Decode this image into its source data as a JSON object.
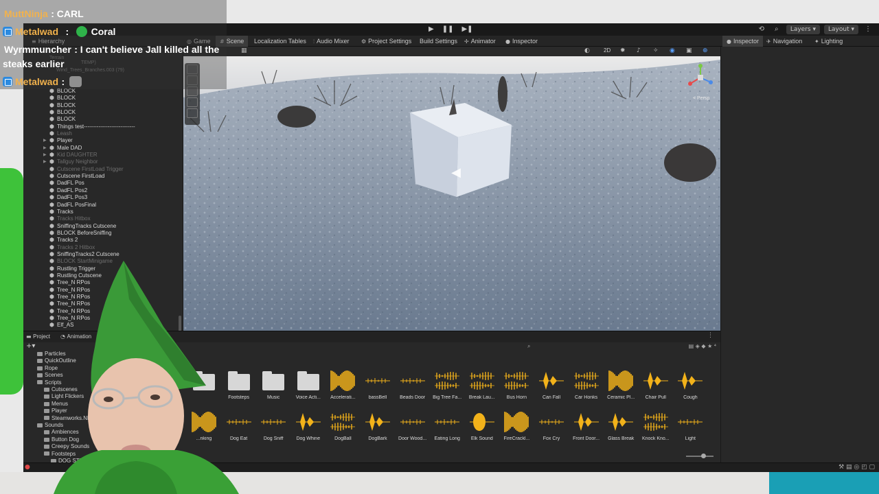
{
  "chat": [
    {
      "user": "MuttNinja",
      "message": ": CARL"
    },
    {
      "user": "Metalwad",
      "message": "Coral"
    },
    {
      "user": "Wyrmmuncher",
      "message": ": I can't believe Jall killed all the",
      "message2": "steaks earlier"
    },
    {
      "user": "Metalwad",
      "message": ":"
    }
  ],
  "toolbar": {
    "play_icons": [
      "▶",
      "❚❚",
      "▶❚"
    ],
    "layers_label": "Layers",
    "layout_label": "Layout"
  },
  "tabs": {
    "hierarchy": "Hierarchy",
    "game": "Game",
    "scene": "Scene",
    "localization": "Localization Tables",
    "audio_mixer": "Audio Mixer",
    "project_settings": "Project Settings",
    "build_settings": "Build Settings",
    "animator": "Animator",
    "inspector_center": "Inspector",
    "inspector": "Inspector",
    "navigation": "Navigation",
    "lighting": "Lighting"
  },
  "scene": {
    "persp_label": "< Persp",
    "mode_2d": "2D"
  },
  "hierarchy": {
    "top_items": [
      "Terrain",
      "Wind_Trees_Branches.003 (79)",
      "TEMP)"
    ],
    "items": [
      {
        "label": "BLOCK",
        "dim": false,
        "fold": false
      },
      {
        "label": "BLOCK",
        "dim": false,
        "fold": false
      },
      {
        "label": "BLOCK",
        "dim": false,
        "fold": false
      },
      {
        "label": "BLOCK",
        "dim": false,
        "fold": false
      },
      {
        "label": "BLOCK",
        "dim": false,
        "fold": false
      },
      {
        "label": "Things test----------------------------",
        "dim": false,
        "fold": false
      },
      {
        "label": "Leash",
        "dim": true,
        "fold": false
      },
      {
        "label": "Player",
        "dim": false,
        "fold": true
      },
      {
        "label": "Male DAD",
        "dim": false,
        "fold": true
      },
      {
        "label": "Kid DAUGHTER",
        "dim": true,
        "fold": true
      },
      {
        "label": "Tallguy Neighbor",
        "dim": true,
        "fold": true
      },
      {
        "label": "Cutscene FirstLoad Trigger",
        "dim": true,
        "fold": false
      },
      {
        "label": "Cutscene FirstLoad",
        "dim": false,
        "fold": false
      },
      {
        "label": "DadFL Pos",
        "dim": false,
        "fold": false
      },
      {
        "label": "DadFL Pos2",
        "dim": false,
        "fold": false
      },
      {
        "label": "DadFL Pos3",
        "dim": false,
        "fold": false
      },
      {
        "label": "DadFL PosFinal",
        "dim": false,
        "fold": false
      },
      {
        "label": "Tracks",
        "dim": false,
        "fold": false
      },
      {
        "label": "Tracks Hitbox",
        "dim": true,
        "fold": false
      },
      {
        "label": "SniffingTracks Cutscene",
        "dim": false,
        "fold": false
      },
      {
        "label": "BLOCK BeforeSniffing",
        "dim": false,
        "fold": false
      },
      {
        "label": "Tracks 2",
        "dim": false,
        "fold": false
      },
      {
        "label": "Tracks 2 Hitbox",
        "dim": true,
        "fold": false
      },
      {
        "label": "SniffingTracks2 Cutscene",
        "dim": false,
        "fold": false
      },
      {
        "label": "BLOCK StartMinigame",
        "dim": true,
        "fold": false
      },
      {
        "label": "Rustling Trigger",
        "dim": false,
        "fold": false
      },
      {
        "label": "Rustling Cutscene",
        "dim": false,
        "fold": false
      },
      {
        "label": "Tree_N RPos",
        "dim": false,
        "fold": false
      },
      {
        "label": "Tree_N RPos",
        "dim": false,
        "fold": false
      },
      {
        "label": "Tree_N RPos",
        "dim": false,
        "fold": false
      },
      {
        "label": "Tree_N RPos",
        "dim": false,
        "fold": false
      },
      {
        "label": "Tree_N RPos",
        "dim": false,
        "fold": false
      },
      {
        "label": "Tree_N RPos",
        "dim": false,
        "fold": false
      },
      {
        "label": "Elf_AS",
        "dim": false,
        "fold": false
      }
    ]
  },
  "project": {
    "tab_project": "Project",
    "tab_animation": "Animation",
    "tree": [
      {
        "label": "Particles",
        "indent": 2
      },
      {
        "label": "QuickOutline",
        "indent": 2
      },
      {
        "label": "Rope",
        "indent": 2
      },
      {
        "label": "Scenes",
        "indent": 2
      },
      {
        "label": "Scripts",
        "indent": 2
      },
      {
        "label": "Cutscenes",
        "indent": 3
      },
      {
        "label": "Light Flickers",
        "indent": 3
      },
      {
        "label": "Menus",
        "indent": 3
      },
      {
        "label": "Player",
        "indent": 3
      },
      {
        "label": "Steamworks.NET",
        "indent": 3
      },
      {
        "label": "Sounds",
        "indent": 2
      },
      {
        "label": "Ambiences",
        "indent": 3
      },
      {
        "label": "Button Dog",
        "indent": 3
      },
      {
        "label": "Creepy Sounds",
        "indent": 3
      },
      {
        "label": "Footsteps",
        "indent": 3
      },
      {
        "label": "DOG STEPS",
        "indent": 4
      }
    ],
    "row1": [
      {
        "name": "",
        "kind": "folder"
      },
      {
        "name": "Footsteps",
        "kind": "folder"
      },
      {
        "name": "Music",
        "kind": "folder"
      },
      {
        "name": "Voice Acti...",
        "kind": "folder"
      },
      {
        "name": "Accelerati...",
        "kind": "dense"
      },
      {
        "name": "bassBell",
        "kind": "thin"
      },
      {
        "name": "Beads Door",
        "kind": "thin"
      },
      {
        "name": "Big Tree Fa...",
        "kind": "stereo"
      },
      {
        "name": "Break Lau...",
        "kind": "stereo"
      },
      {
        "name": "Bus Horn",
        "kind": "stereo"
      },
      {
        "name": "Can Fall",
        "kind": "spike"
      },
      {
        "name": "Car Honks",
        "kind": "stereo"
      },
      {
        "name": "Ceramic Pl...",
        "kind": "dense"
      },
      {
        "name": "Chair Pull",
        "kind": "spike"
      },
      {
        "name": "Cough",
        "kind": "spike"
      }
    ],
    "row2": [
      {
        "name": "...nking",
        "kind": "dense"
      },
      {
        "name": "Dog Eat",
        "kind": "thin"
      },
      {
        "name": "Dog Sniff",
        "kind": "thin"
      },
      {
        "name": "Dog Whine",
        "kind": "spike"
      },
      {
        "name": "DogBall",
        "kind": "stereo"
      },
      {
        "name": "DogBark",
        "kind": "spike"
      },
      {
        "name": "Door Wood...",
        "kind": "thin"
      },
      {
        "name": "Eating Long",
        "kind": "thin"
      },
      {
        "name": "Elk Sound",
        "kind": "blob"
      },
      {
        "name": "FireCrackl...",
        "kind": "dense"
      },
      {
        "name": "Fox Cry",
        "kind": "thin"
      },
      {
        "name": "Front Door...",
        "kind": "spike"
      },
      {
        "name": "Glass Break",
        "kind": "spike"
      },
      {
        "name": "Knock Kno...",
        "kind": "stereo"
      },
      {
        "name": "Light",
        "kind": "thin"
      }
    ]
  },
  "colors": {
    "wave": "#f2b21a",
    "chat_user": "#f2b24c",
    "badge": "#2b8ae0",
    "green": "#3ec23a"
  }
}
